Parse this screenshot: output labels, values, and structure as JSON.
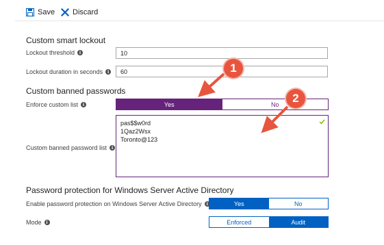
{
  "toolbar": {
    "save_label": "Save",
    "discard_label": "Discard"
  },
  "smart_lockout": {
    "title": "Custom smart lockout",
    "threshold_label": "Lockout threshold",
    "threshold_value": "10",
    "duration_label": "Lockout duration in seconds",
    "duration_value": "60"
  },
  "banned_passwords": {
    "title": "Custom banned passwords",
    "enforce_label": "Enforce custom list",
    "enforce_yes": "Yes",
    "enforce_no": "No",
    "enforce_selected": "Yes",
    "list_label": "Custom banned password list",
    "list_lines": [
      "pas$$w0rd",
      "1Qaz2Wsx",
      "Toronto@123"
    ]
  },
  "ad_protection": {
    "title": "Password protection for Windows Server Active Directory",
    "enable_label": "Enable password protection on Windows Server Active Directory",
    "enable_yes": "Yes",
    "enable_no": "No",
    "enable_selected": "Yes",
    "mode_label": "Mode",
    "mode_enforced": "Enforced",
    "mode_audit": "Audit",
    "mode_selected": "Audit"
  },
  "annotations": {
    "badge1": "1",
    "badge2": "2"
  },
  "colors": {
    "purple_accent": "#66237c",
    "blue_accent": "#0061c2",
    "callout_red": "#e8553e",
    "save_icon": "#0061c2",
    "discard_icon": "#0061c2",
    "checkmark": "#7fba00"
  },
  "icons": {
    "save": "save-icon",
    "discard": "discard-x-icon",
    "info": "info-icon",
    "check": "checkmark-icon"
  }
}
